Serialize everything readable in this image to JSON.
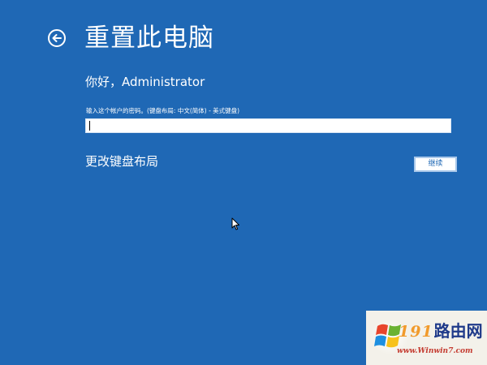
{
  "header": {
    "title": "重置此电脑",
    "back_icon": "back-arrow-icon"
  },
  "account": {
    "greeting": "你好，Administrator"
  },
  "password": {
    "label": "输入这个帐户的密码。(键盘布局: 中文(简体) - 美式键盘)",
    "value": ""
  },
  "actions": {
    "change_layout_label": "更改键盘布局",
    "continue_label": "继续"
  },
  "watermark": {
    "number": "191",
    "name": "路由网",
    "url": "www.Winwin7.com",
    "logo_icon": "windows-flag-logo-icon"
  },
  "colors": {
    "background": "#1f68b5",
    "text": "#ffffff",
    "button_text": "#1f68b5"
  }
}
